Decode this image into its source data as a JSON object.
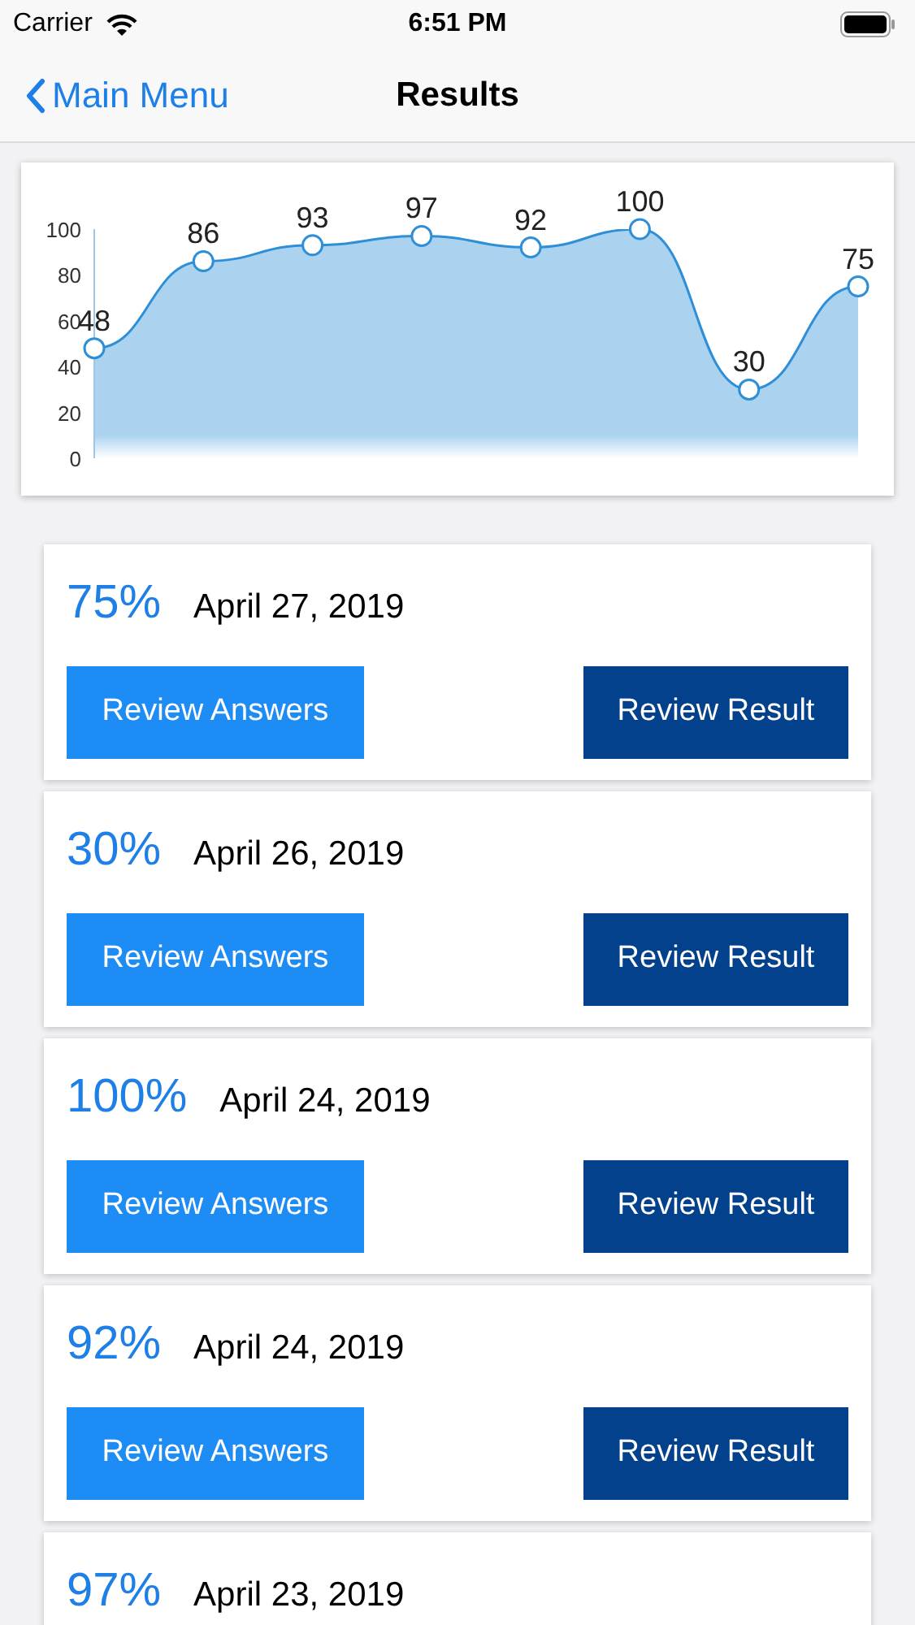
{
  "status_bar": {
    "carrier": "Carrier",
    "time": "6:51 PM"
  },
  "nav": {
    "back": "Main Menu",
    "title": "Results"
  },
  "chart": {
    "chart_data": {
      "type": "area",
      "ylim": [
        0,
        100
      ],
      "yticks": [
        0,
        20,
        40,
        60,
        80,
        100
      ],
      "data_labels": true,
      "series": [
        {
          "color": "#2f8fd6",
          "values": [
            48,
            86,
            93,
            97,
            92,
            100,
            30,
            75
          ]
        }
      ]
    }
  },
  "results": [
    {
      "score": "75%",
      "date": "April 27, 2019",
      "buttons": [
        "Review Answers",
        "Review Result"
      ]
    },
    {
      "score": "30%",
      "date": "April 26, 2019",
      "buttons": [
        "Review Answers",
        "Review Result"
      ]
    },
    {
      "score": "100%",
      "date": "April 24, 2019",
      "buttons": [
        "Review Answers",
        "Review Result"
      ]
    },
    {
      "score": "92%",
      "date": "April 24, 2019",
      "buttons": [
        "Review Answers",
        "Review Result"
      ]
    },
    {
      "score": "97%",
      "date": "April 23, 2019"
    }
  ]
}
